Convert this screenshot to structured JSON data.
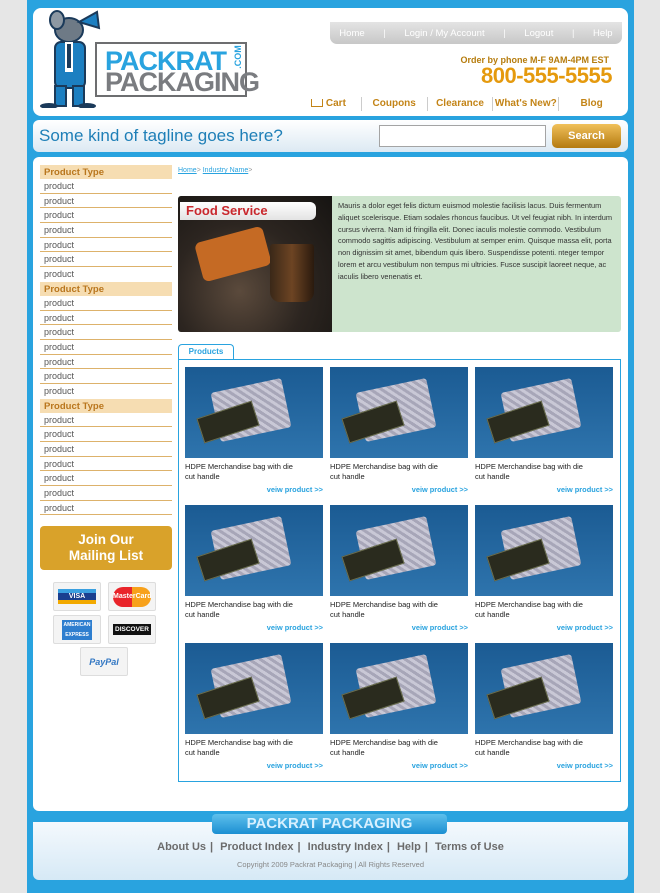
{
  "brand": {
    "line1": "PACKRAT",
    "line2": "PACKAGING",
    "tld": ".COM"
  },
  "top_nav": [
    "Home",
    "Login / My Account",
    "Logout",
    "Help"
  ],
  "phone": {
    "label": "Order by phone M-F 9AM-4PM EST",
    "number": "800-555-5555"
  },
  "main_nav": [
    "Cart",
    "Coupons",
    "Clearance",
    "What's New?",
    "Blog"
  ],
  "tagline": "Some kind of tagline goes here?",
  "search": {
    "placeholder": "",
    "button": "Search"
  },
  "breadcrumb": {
    "home": "Home",
    "sep": ">",
    "current": "Industry Name",
    "trail_sep": ">"
  },
  "sidebar": {
    "groups": [
      {
        "title": "Product Type",
        "items": [
          "product",
          "product",
          "product",
          "product",
          "product",
          "product",
          "product"
        ]
      },
      {
        "title": "Product Type",
        "items": [
          "product",
          "product",
          "product",
          "product",
          "product",
          "product",
          "product"
        ]
      },
      {
        "title": "Product Type",
        "items": [
          "product",
          "product",
          "product",
          "product",
          "product",
          "product",
          "product"
        ]
      }
    ],
    "mailing": {
      "line1": "Join Our",
      "line2": "Mailing List"
    },
    "cards": [
      "VISA",
      "MasterCard",
      "AMERICAN EXPRESS",
      "DISCOVER",
      "PayPal"
    ]
  },
  "feature": {
    "title": "Food Service",
    "text": "Mauris a dolor eget felis dictum euismod molestie facilisis lacus. Duis fermentum aliquet scelerisque. Etiam sodales rhoncus faucibus. Ut vel feugiat nibh. In interdum cursus viverra. Nam id fringilla elit. Donec iaculis molestie commodo. Vestibulum commodo sagittis adipiscing. Vestibulum at semper enim. Quisque massa elit, porta non dignissim sit amet, bibendum quis libero. Suspendisse potenti. nteger tempor lorem et arcu vestibulum non tempus mi ultricies. Fusce suscipit laoreet neque, ac iaculis libero venenatis et."
  },
  "products_tab": "Products",
  "products": [
    {
      "name": "HDPE Merchandise bag with die cut handle",
      "link": "veiw product >>"
    },
    {
      "name": "HDPE Merchandise bag with die cut handle",
      "link": "veiw product >>"
    },
    {
      "name": "HDPE Merchandise bag with die cut handle",
      "link": "veiw product >>"
    },
    {
      "name": "HDPE Merchandise bag with die cut handle",
      "link": "veiw product >>"
    },
    {
      "name": "HDPE Merchandise bag with die cut handle",
      "link": "veiw product >>"
    },
    {
      "name": "HDPE Merchandise bag with die cut handle",
      "link": "veiw product >>"
    },
    {
      "name": "HDPE Merchandise bag with die cut handle",
      "link": "veiw product >>"
    },
    {
      "name": "HDPE Merchandise bag with die cut handle",
      "link": "veiw product >>"
    },
    {
      "name": "HDPE Merchandise bag with die cut handle",
      "link": "veiw product >>"
    }
  ],
  "footer": {
    "logo": "PACKRAT PACKAGING",
    "links": [
      "About Us",
      "Product Index",
      "Industry Index",
      "Help",
      "Terms of Use"
    ],
    "copyright": "Copyright 2009 Packrat Packaging | All Rights Reserved"
  },
  "colors": {
    "frame": "#29a3df",
    "accent": "#d9a22a",
    "link": "#29a3df",
    "feature_bg": "#cde4cd"
  }
}
